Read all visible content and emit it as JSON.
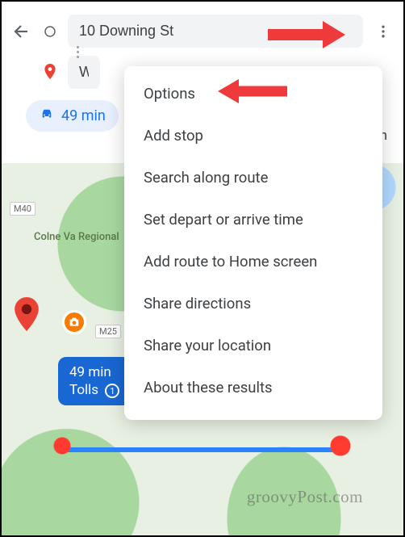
{
  "header": {
    "origin_input": "10 Downing St",
    "dest_input": "W"
  },
  "chip": {
    "drive_time": "49 min",
    "right_suffix": "in"
  },
  "menu": {
    "items": [
      "Options",
      "Add stop",
      "Search along route",
      "Set depart or arrive time",
      "Add route to Home screen",
      "Share directions",
      "Share your location",
      "About these results"
    ]
  },
  "route_tooltip": {
    "line1": "49 min",
    "line2": "Tolls",
    "badge": "1"
  },
  "map_labels": {
    "region": "Colne Va\nRegional",
    "m40": "M40",
    "m25": "M25"
  },
  "watermark": "groovyPost.com"
}
